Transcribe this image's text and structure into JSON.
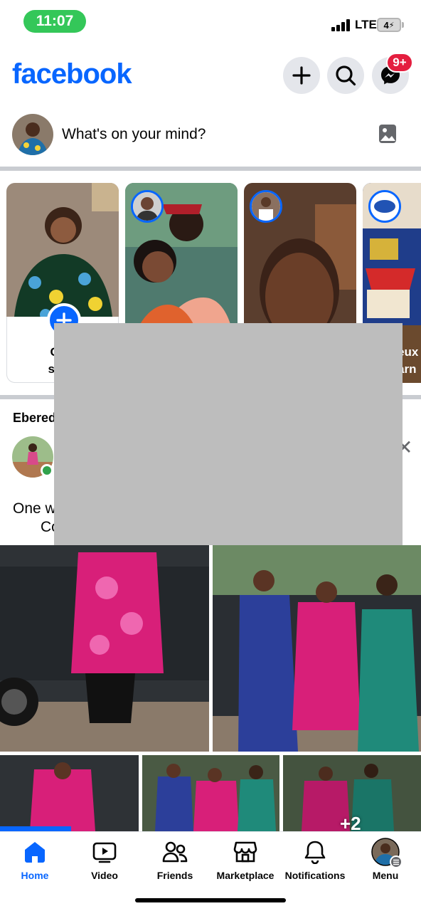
{
  "status_bar": {
    "time": "11:07",
    "network": "LTE",
    "battery": "4"
  },
  "header": {
    "logo": "facebook",
    "message_badge": "9+",
    "colors": {
      "brand": "#0866ff",
      "badge": "#e41e3f"
    }
  },
  "composer": {
    "placeholder": "What's on your mind?"
  },
  "stories": {
    "create_label_line1": "Cr",
    "create_label_line2": "st",
    "partial_name_line1": "eux",
    "partial_name_line2": "arn"
  },
  "post": {
    "author_partial": "Ebered",
    "text_line1": "One w",
    "text_line2": "Co",
    "more_photos": "+2"
  },
  "tabs": [
    {
      "label": "Home",
      "icon": "home-icon",
      "active": true
    },
    {
      "label": "Video",
      "icon": "video-icon",
      "active": false
    },
    {
      "label": "Friends",
      "icon": "friends-icon",
      "active": false
    },
    {
      "label": "Marketplace",
      "icon": "marketplace-icon",
      "active": false
    },
    {
      "label": "Notifications",
      "icon": "bell-icon",
      "active": false
    },
    {
      "label": "Menu",
      "icon": "menu-avatar",
      "active": false
    }
  ]
}
